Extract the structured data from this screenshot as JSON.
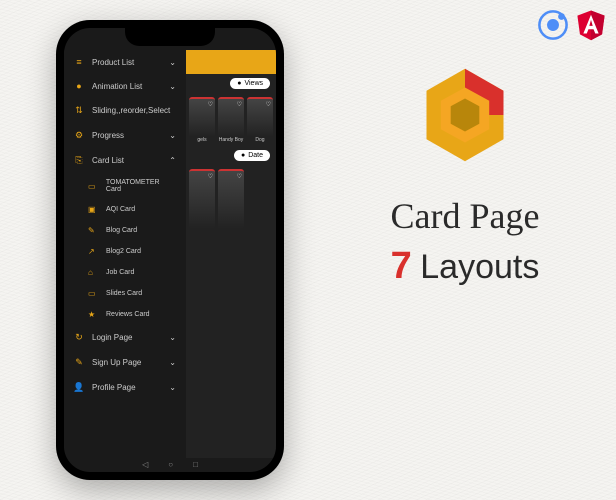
{
  "corner": {
    "ionic": "ionic-logo",
    "angular": "angular-logo"
  },
  "menu": {
    "items": [
      {
        "icon": "≡",
        "label": "Product List",
        "expandable": true
      },
      {
        "icon": "●",
        "label": "Animation List",
        "expandable": true
      },
      {
        "icon": "⇅",
        "label": "Sliding,,reorder,Select",
        "expandable": false
      },
      {
        "icon": "⚙",
        "label": "Progress",
        "expandable": true
      },
      {
        "icon": "⎘",
        "label": "Card List",
        "expandable": true,
        "open": true
      }
    ],
    "subitems": [
      {
        "icon": "▭",
        "label": "TOMATOMETER Card"
      },
      {
        "icon": "▣",
        "label": "AQI Card"
      },
      {
        "icon": "✎",
        "label": "Blog Card"
      },
      {
        "icon": "↗",
        "label": "Blog2 Card"
      },
      {
        "icon": "⌂",
        "label": "Job Card"
      },
      {
        "icon": "▭",
        "label": "Slides Card"
      },
      {
        "icon": "★",
        "label": "Reviews Card"
      }
    ],
    "after": [
      {
        "icon": "↻",
        "label": "Login Page",
        "expandable": true
      },
      {
        "icon": "✎",
        "label": "Sign Up Page",
        "expandable": true
      },
      {
        "icon": "👤",
        "label": "Profile Page",
        "expandable": true
      }
    ]
  },
  "main": {
    "pill1": "Views",
    "pill2": "Date",
    "cards1": [
      "gels",
      "Handy Boy",
      "Dog"
    ]
  },
  "title": {
    "line1": "Card Page",
    "count": "7",
    "line2": "Layouts"
  }
}
